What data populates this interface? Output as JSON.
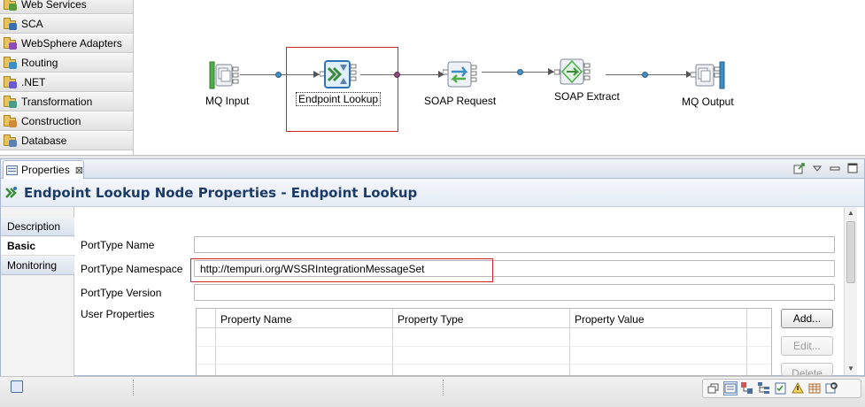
{
  "palette": {
    "items": [
      {
        "label": "Web Services",
        "icon": "folder-web-services-icon",
        "badge_color": "#5a9a3c"
      },
      {
        "label": "SCA",
        "icon": "folder-sca-icon",
        "badge_color": "#3c6fb0"
      },
      {
        "label": "WebSphere Adapters",
        "icon": "folder-websphere-adapters-icon",
        "badge_color": "#8a4cb5"
      },
      {
        "label": "Routing",
        "icon": "folder-routing-icon",
        "badge_color": "#3c8ec4"
      },
      {
        "label": ".NET",
        "icon": "folder-dotnet-icon",
        "badge_color": "#6a5ad0"
      },
      {
        "label": "Transformation",
        "icon": "folder-transformation-icon",
        "badge_color": "#4a9a8a"
      },
      {
        "label": "Construction",
        "icon": "folder-construction-icon",
        "badge_color": "#d08a3c"
      },
      {
        "label": "Database",
        "icon": "folder-database-icon",
        "badge_color": "#5a7fb0"
      }
    ]
  },
  "flow": {
    "nodes": [
      {
        "label": "MQ Input",
        "icon": "mq-input-icon"
      },
      {
        "label": "Endpoint Lookup",
        "icon": "endpoint-lookup-icon"
      },
      {
        "label": "SOAP Request",
        "icon": "soap-request-icon"
      },
      {
        "label": "SOAP Extract",
        "icon": "soap-extract-icon"
      },
      {
        "label": "MQ Output",
        "icon": "mq-output-icon"
      }
    ]
  },
  "properties_view": {
    "tab_label": "Properties",
    "close_glyph": "⊠",
    "title": "Endpoint Lookup Node Properties - Endpoint Lookup",
    "side_tabs": [
      "Description",
      "Basic",
      "Monitoring"
    ],
    "active_side_tab": "Basic",
    "fields": [
      {
        "label": "PortType Name",
        "value": ""
      },
      {
        "label": "PortType Namespace",
        "value": "http://tempuri.org/WSSRIntegrationMessageSet"
      },
      {
        "label": "PortType Version",
        "value": ""
      }
    ],
    "user_properties": {
      "label": "User Properties",
      "columns": [
        "Property Name",
        "Property Type",
        "Property Value"
      ],
      "buttons": {
        "add": "Add...",
        "edit": "Edit...",
        "delete": "Delete"
      }
    }
  },
  "colors": {
    "selection_red": "#cc2a2a",
    "header_text": "#1c3a67",
    "connection_dot": "#4a8fc1"
  }
}
